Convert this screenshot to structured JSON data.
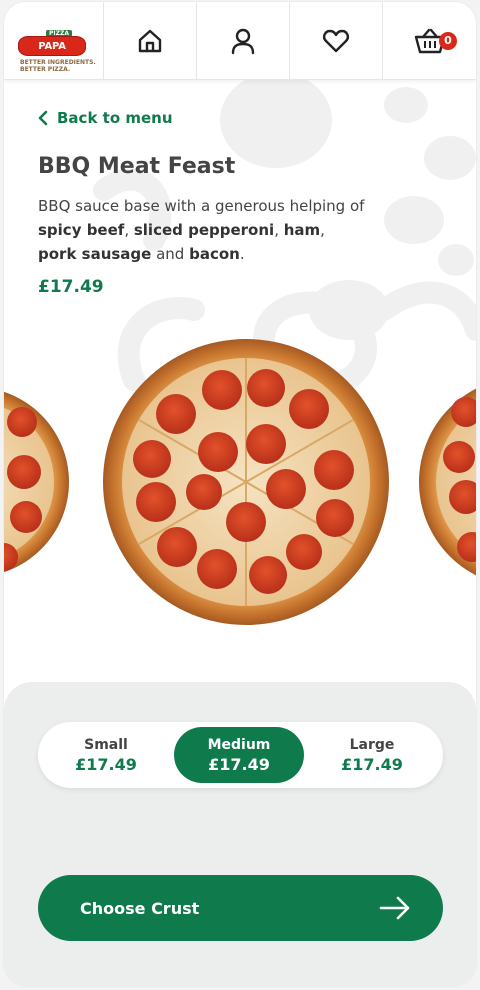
{
  "brand": {
    "logo_top": "PIZZA",
    "logo_main": "PAPA JOHN'S",
    "tagline_line1": "BETTER INGREDIENTS.",
    "tagline_line2": "BETTER PIZZA."
  },
  "nav": {
    "items": [
      {
        "icon": "home-icon"
      },
      {
        "icon": "account-icon"
      },
      {
        "icon": "heart-icon"
      },
      {
        "icon": "basket-icon"
      }
    ],
    "cart_count": "0"
  },
  "product": {
    "back_label": "Back to menu",
    "title": "BBQ Meat Feast",
    "desc_parts": {
      "p1": "BBQ sauce base with a generous helping of ",
      "b1": "spicy beef",
      "p2": ", ",
      "b2": "sliced pepperoni",
      "p3": ", ",
      "b3": "ham",
      "p4": ", ",
      "b4": "pork sausage",
      "p5": " and ",
      "b5": "bacon",
      "p6": "."
    },
    "price": "£17.49"
  },
  "sizes": [
    {
      "name": "Small",
      "price": "£17.49",
      "selected": false
    },
    {
      "name": "Medium",
      "price": "£17.49",
      "selected": true
    },
    {
      "name": "Large",
      "price": "£17.49",
      "selected": false
    }
  ],
  "cta": {
    "label": "Choose Crust",
    "icon": "arrow-right-icon"
  },
  "colors": {
    "brand_green": "#0f7a4c",
    "brand_red": "#d9281a",
    "panel_bg": "#eceeed"
  }
}
